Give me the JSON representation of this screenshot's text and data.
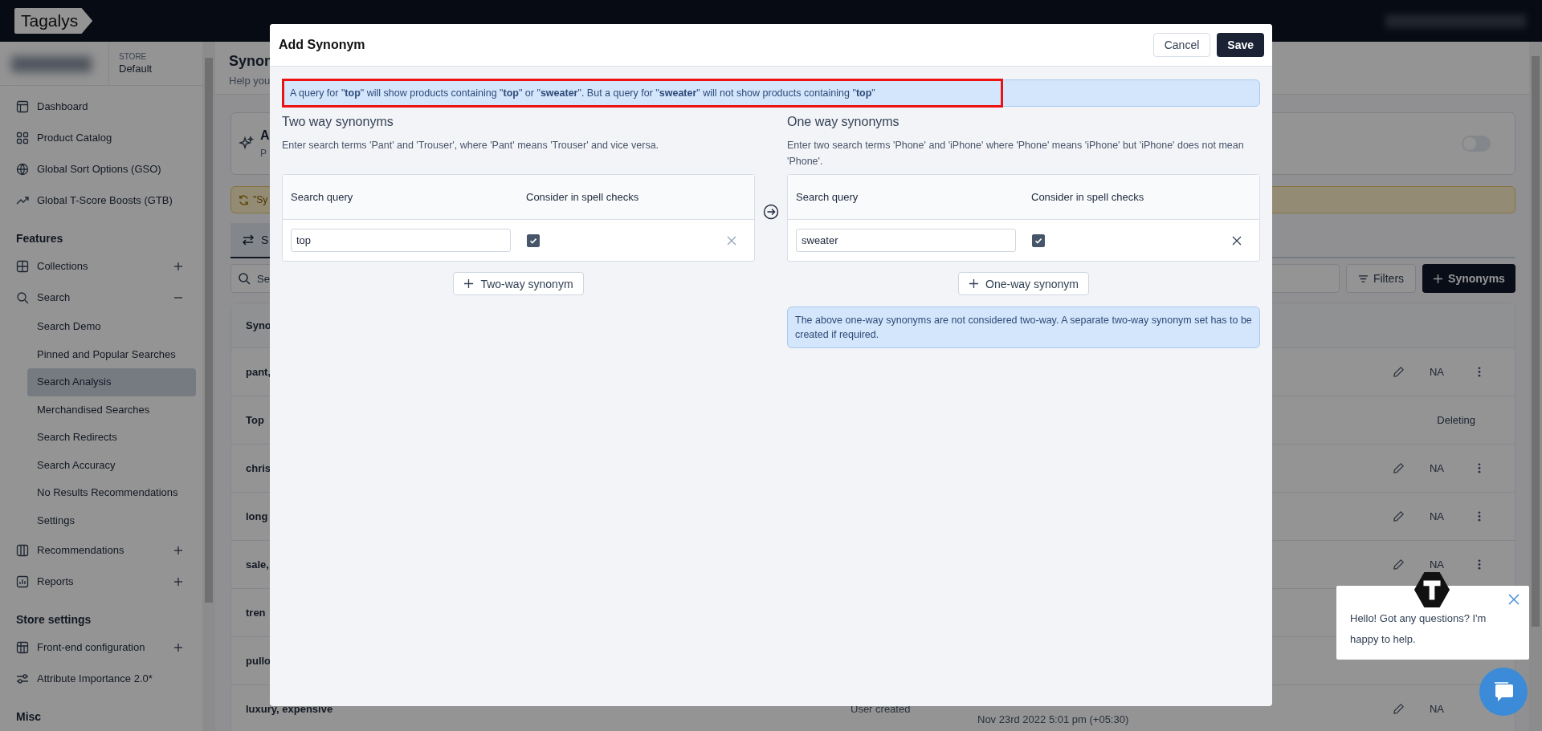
{
  "topbar": {
    "logo": "Tagalys"
  },
  "sidebar": {
    "store_label": "STORE",
    "store_name": "Default",
    "sections": [
      {
        "items": [
          {
            "label": "Dashboard",
            "selected": false
          },
          {
            "label": "Product Catalog",
            "selected": false
          },
          {
            "label": "Global Sort Options (GSO)",
            "selected": false
          },
          {
            "label": "Global T-Score Boosts (GTB)",
            "selected": false
          }
        ]
      },
      {
        "title": "Features",
        "items": [
          {
            "label": "Collections",
            "selected": false,
            "expanded": false
          },
          {
            "label": "Search",
            "selected": false,
            "expanded": true,
            "children": [
              {
                "label": "Search Demo",
                "selected": false
              },
              {
                "label": "Pinned and Popular Searches",
                "selected": false
              },
              {
                "label": "Search Analysis",
                "selected": true
              },
              {
                "label": "Merchandised Searches",
                "selected": false
              },
              {
                "label": "Search Redirects",
                "selected": false
              },
              {
                "label": "Search Accuracy",
                "selected": false
              },
              {
                "label": "No Results Recommendations",
                "selected": false
              },
              {
                "label": "Settings",
                "selected": false
              }
            ]
          },
          {
            "label": "Recommendations",
            "selected": false,
            "expanded": false
          },
          {
            "label": "Reports",
            "selected": false,
            "expanded": false
          }
        ]
      },
      {
        "title": "Store settings",
        "items": [
          {
            "label": "Front-end configuration",
            "selected": false,
            "expanded": false
          },
          {
            "label": "Attribute Importance 2.0*",
            "selected": false
          }
        ]
      },
      {
        "title": "Misc"
      }
    ]
  },
  "page": {
    "title": "Synon",
    "subtitle": "Help you"
  },
  "feature_card": {
    "title": "A",
    "subtitle": "P",
    "on": false
  },
  "banner": {
    "text": "\"Sy"
  },
  "tabs": [
    {
      "label": "S",
      "selected": true
    }
  ],
  "search": {
    "placeholder": "Se"
  },
  "filters_button": "Filters",
  "add_button": "Synonyms",
  "table": {
    "columns": [
      "Syno"
    ],
    "rows": [
      {
        "name": "pant,",
        "editable": true,
        "na": "NA",
        "menu": true
      },
      {
        "name": "Top",
        "status": "Deleting",
        "editable": false,
        "menu": false
      },
      {
        "name": "chris",
        "editable": true,
        "na": "NA",
        "menu": true
      },
      {
        "name": "long",
        "editable": true,
        "na": "NA",
        "menu": true
      },
      {
        "name": "sale,",
        "editable": true,
        "na": "NA",
        "menu": true
      },
      {
        "name": "tren",
        "editable": false,
        "menu": false
      },
      {
        "name": "pullo",
        "editable": false,
        "menu": false
      },
      {
        "name": "luxury, expensive",
        "source": "User created",
        "date": "Nov 23rd 2022 5:01 pm (+05:30)",
        "editable": true,
        "na": "NA",
        "menu": false
      }
    ]
  },
  "modal": {
    "title": "Add Synonym",
    "cancel": "Cancel",
    "save": "Save",
    "info": "A query for \"**top**\" will show products containing \"**top**\" or \"**sweater**\". But a query for \"**sweater**\" will not show products containing \"**top**\"",
    "panels": [
      {
        "heading": "Two way synonyms",
        "description": "Enter search terms 'Pant' and 'Trouser', where 'Pant' means 'Trouser' and vice versa.",
        "columns": [
          "Search query",
          "Consider in spell checks"
        ],
        "rows": [
          {
            "query": "top",
            "spell_check": true
          }
        ],
        "add_button": "Two-way synonym"
      },
      {
        "heading": "One way synonyms",
        "description": "Enter two search terms 'Phone' and 'iPhone' where 'Phone' means 'iPhone' but 'iPhone' does not mean 'Phone'.",
        "columns": [
          "Search query",
          "Consider in spell checks"
        ],
        "rows": [
          {
            "query": "sweater",
            "spell_check": true
          }
        ],
        "add_button": "One-way synonym",
        "note": "The above one-way synonyms are not considered two-way. A separate two-way synonym set has to be created if required."
      }
    ]
  },
  "chat": {
    "message": "Hello! Got any questions? I'm happy to help."
  }
}
